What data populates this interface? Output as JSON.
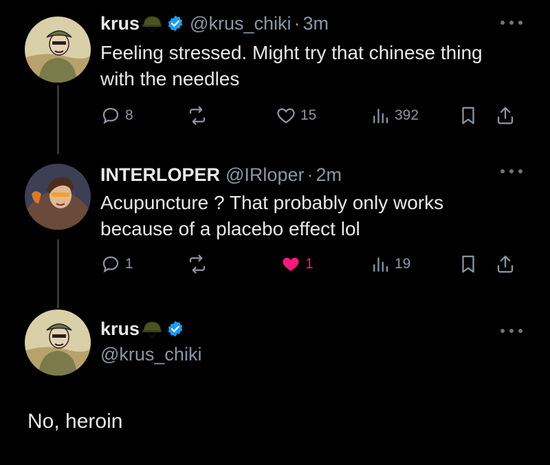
{
  "posts": [
    {
      "name": "krus",
      "emoji": "military-helmet",
      "verified": true,
      "handle": "@krus_chiki",
      "separator": "·",
      "time": "3m",
      "text": "Feeling stressed. Might try that chinese thing with the needles",
      "actions": {
        "replies": "8",
        "reposts": "",
        "likes": "15",
        "views": "392"
      },
      "liked": false
    },
    {
      "name": "INTERLOPER",
      "verified": false,
      "handle": "@IRloper",
      "separator": "·",
      "time": "2m",
      "text": "Acupuncture ? That probably only works because of a placebo effect lol",
      "actions": {
        "replies": "1",
        "reposts": "",
        "likes": "1",
        "views": "19"
      },
      "liked": true
    },
    {
      "name": "krus",
      "emoji": "military-helmet",
      "verified": true,
      "handle": "@krus_chiki",
      "text": "No, heroin"
    }
  ],
  "colors": {
    "background": "#000000",
    "text": "#e7e9ea",
    "secondary": "#8b98a5",
    "verified": "#1d9bf0",
    "like": "#f91880"
  }
}
